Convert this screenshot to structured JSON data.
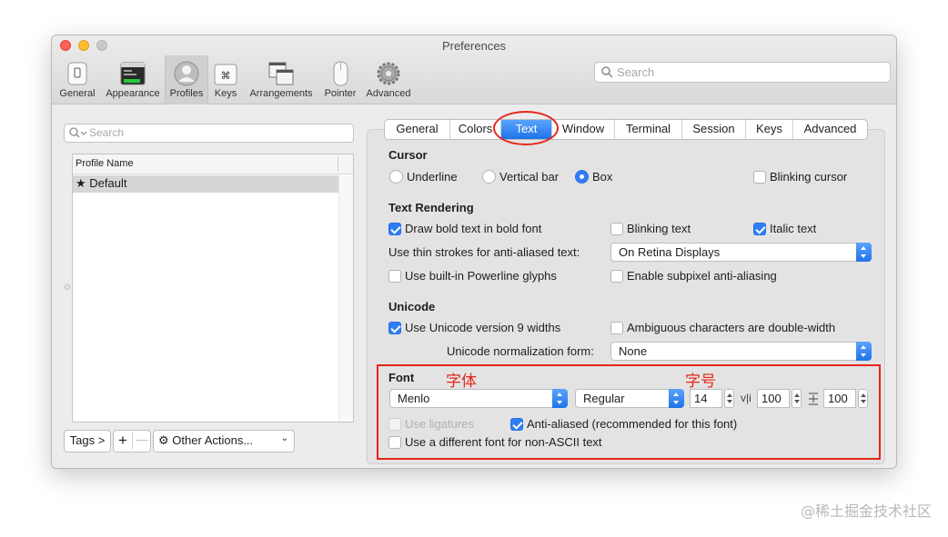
{
  "window": {
    "title": "Preferences"
  },
  "toolbar": {
    "items": [
      {
        "label": "General",
        "icon": "general-switch-icon"
      },
      {
        "label": "Appearance",
        "icon": "appearance-window-icon"
      },
      {
        "label": "Profiles",
        "icon": "profiles-person-icon",
        "selected": true
      },
      {
        "label": "Keys",
        "icon": "command-key-icon"
      },
      {
        "label": "Arrangements",
        "icon": "arrangements-windows-icon"
      },
      {
        "label": "Pointer",
        "icon": "mouse-pointer-icon"
      },
      {
        "label": "Advanced",
        "icon": "gear-icon"
      }
    ],
    "search_placeholder": "Search"
  },
  "sidebar": {
    "search_placeholder": "Search",
    "column_header": "Profile Name",
    "profiles": [
      {
        "name": "Default",
        "is_default": true
      }
    ],
    "buttons": {
      "tags": "Tags >",
      "add": "+",
      "remove": "—",
      "other_actions": "Other Actions..."
    }
  },
  "tabs": [
    "General",
    "Colors",
    "Text",
    "Window",
    "Terminal",
    "Session",
    "Keys",
    "Advanced"
  ],
  "selected_tab": "Text",
  "cursor": {
    "title": "Cursor",
    "options": [
      "Underline",
      "Vertical bar",
      "Box"
    ],
    "selected": "Box",
    "blinking_label": "Blinking cursor",
    "blinking": false
  },
  "text_rendering": {
    "title": "Text Rendering",
    "bold_label": "Draw bold text in bold font",
    "bold": true,
    "blinking_text_label": "Blinking text",
    "blinking_text": false,
    "italic_label": "Italic text",
    "italic": true,
    "thin_strokes_label": "Use thin strokes for anti-aliased text:",
    "thin_strokes_value": "On Retina Displays",
    "powerline_label": "Use built-in Powerline glyphs",
    "powerline": false,
    "subpixel_label": "Enable subpixel anti-aliasing",
    "subpixel": false
  },
  "unicode": {
    "title": "Unicode",
    "v9_label": "Use Unicode version 9 widths",
    "v9": true,
    "ambiguous_label": "Ambiguous characters are double-width",
    "ambiguous": false,
    "normalization_label": "Unicode normalization form:",
    "normalization_value": "None"
  },
  "font": {
    "title": "Font",
    "family": "Menlo",
    "style": "Regular",
    "size": "14",
    "h_spacing": "100",
    "v_spacing": "100",
    "h_spacing_icon": "v|i",
    "v_spacing_icon": "line-spacing-icon",
    "ligatures_label": "Use ligatures",
    "ligatures": false,
    "antialiased_label": "Anti-aliased (recommended for this font)",
    "antialiased": true,
    "non_ascii_label": "Use a different font for non-ASCII text",
    "non_ascii": false
  },
  "annotations": {
    "font_label": "字体",
    "size_label": "字号",
    "color": "#e4261b"
  },
  "watermark": "@稀土掘金技术社区",
  "colors": {
    "accent": "#2f7df6",
    "annotation": "#e4261b"
  }
}
